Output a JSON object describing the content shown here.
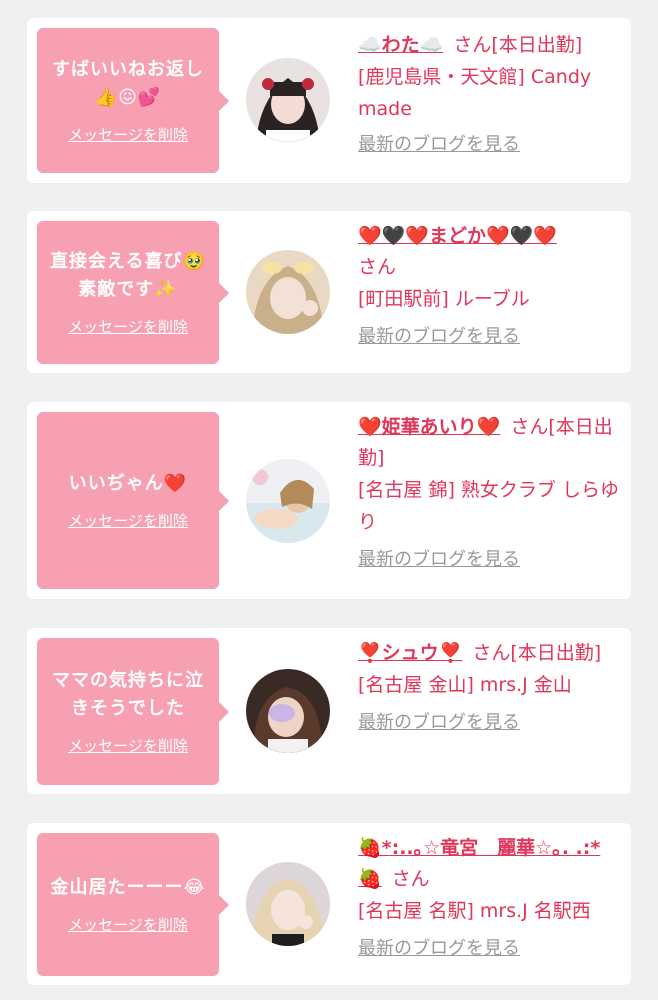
{
  "items": [
    {
      "message": "すばいいねお返し👍😖💕",
      "delete_label": "メッセージを削除",
      "name": "☁️わた☁️",
      "suffix": "さん",
      "status": "[本日出勤]",
      "shop": "[鹿児島県・天文館] Candy made",
      "blog_label": "最新のブログを見る",
      "avatar_icon": "avatar-photo"
    },
    {
      "message": "直接会える喜び🥹素敵です✨",
      "delete_label": "メッセージを削除",
      "name": "❤️🖤❤️まどか❤️🖤❤️",
      "suffix": "さん",
      "status": "",
      "shop": "[町田駅前] ルーブル",
      "blog_label": "最新のブログを見る",
      "avatar_icon": "avatar-photo"
    },
    {
      "message": "いいぢゃん❤️",
      "delete_label": "メッセージを削除",
      "name": "❤️姫華あいり❤️",
      "suffix": "さん",
      "status": "[本日出勤]",
      "shop": "[名古屋 錦] 熟女クラブ しらゆり",
      "blog_label": "最新のブログを見る",
      "avatar_icon": "avatar-photo"
    },
    {
      "message": "ママの気持ちに泣きそうでした",
      "delete_label": "メッセージを削除",
      "name": "❣️シュウ❣️",
      "suffix": "さん",
      "status": "[本日出勤]",
      "shop": "[名古屋 金山] mrs.J 金山",
      "blog_label": "最新のブログを見る",
      "avatar_icon": "avatar-photo"
    },
    {
      "message": "金山居たーーー😂",
      "delete_label": "メッセージを削除",
      "name": "🍓*:..｡☆竜宮　麗華☆｡. .:*🍓",
      "suffix": "さん",
      "status": "",
      "shop": "[名古屋 名駅] mrs.J 名駅西",
      "blog_label": "最新のブログを見る",
      "avatar_icon": "avatar-photo"
    }
  ],
  "colors": {
    "accent": "#e0365a",
    "bubble": "#f7a0b2",
    "muted": "#999999",
    "background": "#f0f0f0"
  }
}
